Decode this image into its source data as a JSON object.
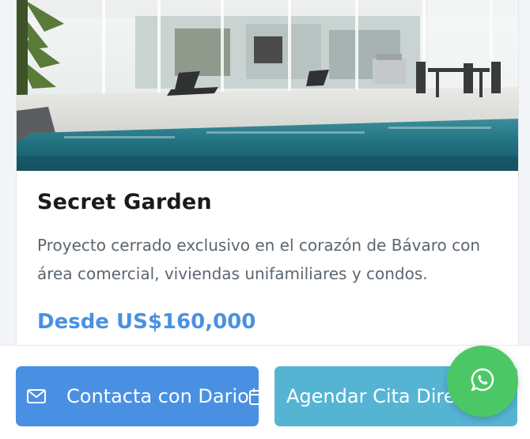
{
  "listing": {
    "image_alt": "Villa con piscina y terraza acristalada",
    "title": "Secret Garden",
    "description": "Proyecto cerrado exclusivo en el corazón de Bávaro con área comercial, viviendas unifamiliares y condos.",
    "price": "Desde US$160,000"
  },
  "actions": {
    "contact_label": "Contacta con Dario",
    "contact_icon": "mail-icon",
    "contact_trailing_icon": "calendar-icon",
    "appointment_label": "Agendar Cita Directa",
    "appointment_icon": "calendar-icon",
    "whatsapp_icon": "whatsapp-icon"
  },
  "colors": {
    "primary_blue": "#4a90e2",
    "secondary_teal": "#56b4d3",
    "whatsapp_green": "#4bc865",
    "title_text": "#1a1a1a",
    "body_text": "#5c6670"
  }
}
